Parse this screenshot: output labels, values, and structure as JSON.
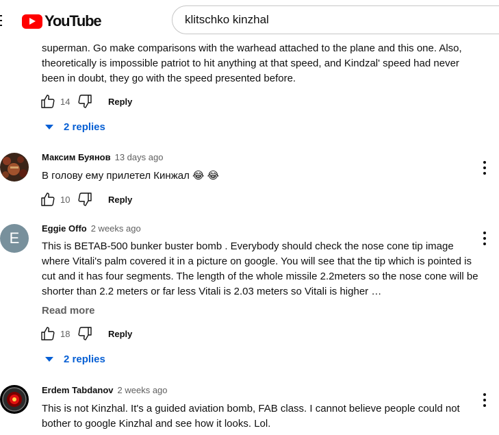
{
  "header": {
    "logo_text": "YouTube",
    "search_value": "klitschko kinzhal"
  },
  "comments": [
    {
      "text": "superman. Go make comparisons with the warhead attached to the plane and this one. Also, theoretically is impossible patriot to hit anything at that speed, and Kindzal' speed had never been in doubt, they go with the speed presented before.",
      "likes": "14",
      "reply_label": "Reply",
      "replies_label": "2 replies"
    },
    {
      "author": "Максим Буянов",
      "time": "13 days ago",
      "text": "В голову ему прилетел Кинжал 😂 😂",
      "likes": "10",
      "reply_label": "Reply"
    },
    {
      "author": "Eggie Offo",
      "time": "2 weeks ago",
      "avatar_letter": "E",
      "avatar_color": "#78909c",
      "text": "This is BETAB-500 bunker buster bomb . Everybody should check the nose cone tip image where Vitali's  palm covered it in a picture on google. You will see that the tip which is pointed is cut and it has four segments. The length of the whole missile 2.2meters so the nose cone will be shorter than 2.2 meters or far less Vitali is 2.03 meters so Vitali is higher …",
      "read_more": "Read more",
      "likes": "18",
      "reply_label": "Reply",
      "replies_label": "2 replies"
    },
    {
      "author": "Erdem Tabdanov",
      "time": "2 weeks ago",
      "text": "This is not Kinzhal. It's a guided aviation bomb, FAB class. I cannot believe people could not bother to google Kinzhal and see how it looks. Lol."
    }
  ],
  "colors": {
    "accent_blue": "#065fd4",
    "brand_red": "#ff0000",
    "secondary_text": "#606060"
  }
}
